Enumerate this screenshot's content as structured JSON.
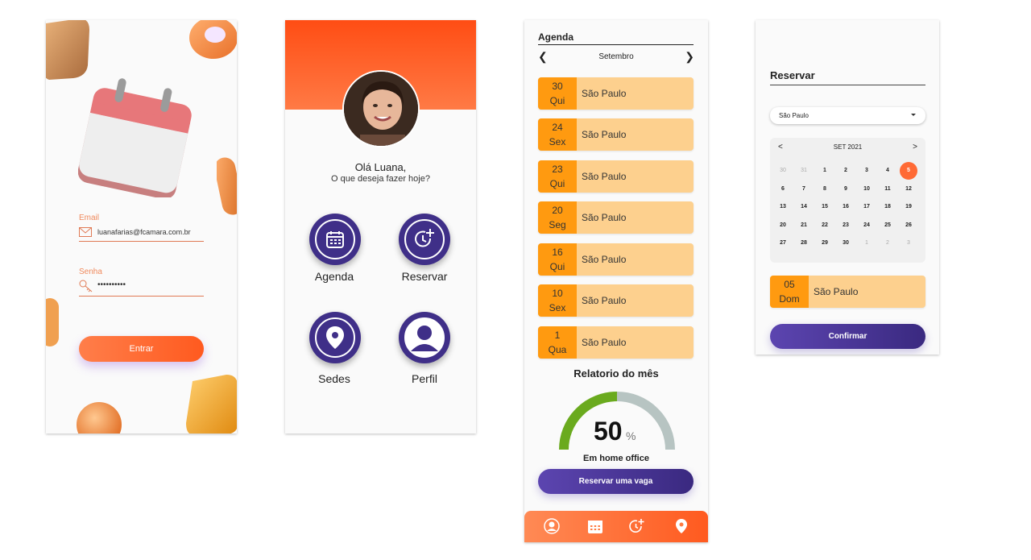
{
  "login": {
    "email_label": "Email",
    "email_value": "luanafarias@fcamara.com.br",
    "password_label": "Senha",
    "password_value": "••••••••••",
    "submit_label": "Entrar"
  },
  "home": {
    "greeting": "Olá Luana,",
    "question": "O que deseja fazer hoje?",
    "menu": [
      {
        "label": "Agenda",
        "icon": "calendar-icon"
      },
      {
        "label": "Reservar",
        "icon": "clock-plus-icon"
      },
      {
        "label": "Sedes",
        "icon": "location-pin-icon"
      },
      {
        "label": "Perfil",
        "icon": "user-icon"
      }
    ],
    "colors": {
      "header": "#ff5a1f",
      "menu_button": "#3f2f88"
    }
  },
  "agenda": {
    "title": "Agenda",
    "month": "Setembro",
    "items": [
      {
        "day": "30",
        "weekday": "Qui",
        "city": "São Paulo"
      },
      {
        "day": "24",
        "weekday": "Sex",
        "city": "São Paulo"
      },
      {
        "day": "23",
        "weekday": "Qui",
        "city": "São Paulo"
      },
      {
        "day": "20",
        "weekday": "Seg",
        "city": "São Paulo"
      },
      {
        "day": "16",
        "weekday": "Qui",
        "city": "São Paulo"
      },
      {
        "day": "10",
        "weekday": "Sex",
        "city": "São Paulo"
      },
      {
        "day": "1",
        "weekday": "Qua",
        "city": "São Paulo"
      }
    ],
    "report_title": "Relatorio do mês",
    "report_value": "50",
    "report_unit": "%",
    "report_fraction": 0.5,
    "report_label": "Em home office",
    "cta_label": "Reservar uma vaga",
    "bottom_nav": [
      "user-icon",
      "calendar-icon",
      "clock-plus-icon",
      "location-pin-icon"
    ],
    "colors": {
      "gauge_done": "#6aaa1e",
      "gauge_rest": "#b7c4c2"
    }
  },
  "reservar": {
    "title": "Reservar",
    "location_selected": "São Paulo",
    "calendar_month": "SET 2021",
    "prev": "<",
    "next": ">",
    "weeks": [
      [
        "30",
        "31",
        "1",
        "2",
        "3",
        "4",
        "5"
      ],
      [
        "6",
        "7",
        "8",
        "9",
        "10",
        "11",
        "12"
      ],
      [
        "13",
        "14",
        "15",
        "16",
        "17",
        "18",
        "19"
      ],
      [
        "20",
        "21",
        "22",
        "23",
        "24",
        "25",
        "26"
      ],
      [
        "27",
        "28",
        "29",
        "30",
        "1",
        "2",
        "3"
      ]
    ],
    "selected_day": "5",
    "reservation": {
      "day": "05",
      "weekday": "Dom",
      "city": "São Paulo"
    },
    "confirm_label": "Confirmar"
  }
}
